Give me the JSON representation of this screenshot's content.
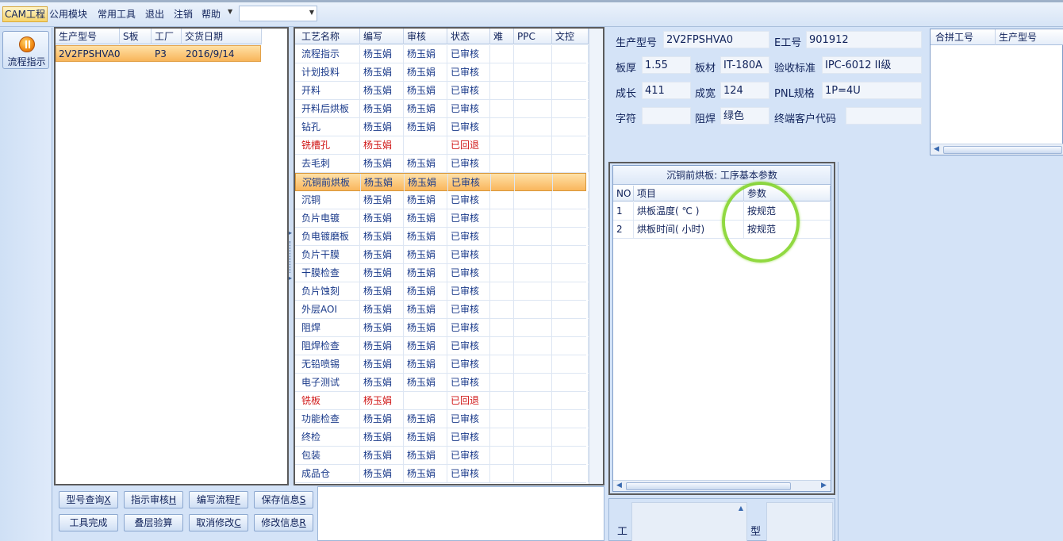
{
  "menu": {
    "items": [
      "CAM工程",
      "公用模块",
      "常用工具",
      "退出",
      "注销",
      "帮助"
    ],
    "combo_value": ""
  },
  "leftnav": {
    "label": "流程指示"
  },
  "product_list": {
    "headers": [
      "生产型号",
      "S板",
      "工厂",
      "交货日期"
    ],
    "rows": [
      {
        "model": "2V2FPSHVA0",
        "s": "",
        "factory": "P3",
        "date": "2016/9/14"
      }
    ]
  },
  "process_list": {
    "headers": [
      "工艺名称",
      "编写",
      "审核",
      "状态",
      "难",
      "PPC",
      "文控"
    ],
    "rows": [
      {
        "name": "流程指示",
        "writer": "杨玉娟",
        "auditor": "杨玉娟",
        "status": "已审核",
        "state": "normal"
      },
      {
        "name": "计划投料",
        "writer": "杨玉娟",
        "auditor": "杨玉娟",
        "status": "已审核",
        "state": "normal"
      },
      {
        "name": "开料",
        "writer": "杨玉娟",
        "auditor": "杨玉娟",
        "status": "已审核",
        "state": "normal"
      },
      {
        "name": "开料后烘板",
        "writer": "杨玉娟",
        "auditor": "杨玉娟",
        "status": "已审核",
        "state": "normal"
      },
      {
        "name": "钻孔",
        "writer": "杨玉娟",
        "auditor": "杨玉娟",
        "status": "已审核",
        "state": "normal"
      },
      {
        "name": "铣槽孔",
        "writer": "杨玉娟",
        "auditor": "",
        "status": "已回退",
        "state": "red"
      },
      {
        "name": "去毛刺",
        "writer": "杨玉娟",
        "auditor": "杨玉娟",
        "status": "已审核",
        "state": "normal"
      },
      {
        "name": "沉铜前烘板",
        "writer": "杨玉娟",
        "auditor": "杨玉娟",
        "status": "已审核",
        "state": "sel"
      },
      {
        "name": "沉铜",
        "writer": "杨玉娟",
        "auditor": "杨玉娟",
        "status": "已审核",
        "state": "normal"
      },
      {
        "name": "负片电镀",
        "writer": "杨玉娟",
        "auditor": "杨玉娟",
        "status": "已审核",
        "state": "normal"
      },
      {
        "name": "负电镀磨板",
        "writer": "杨玉娟",
        "auditor": "杨玉娟",
        "status": "已审核",
        "state": "normal"
      },
      {
        "name": "负片干膜",
        "writer": "杨玉娟",
        "auditor": "杨玉娟",
        "status": "已审核",
        "state": "normal"
      },
      {
        "name": "干膜检查",
        "writer": "杨玉娟",
        "auditor": "杨玉娟",
        "status": "已审核",
        "state": "normal"
      },
      {
        "name": "负片蚀刻",
        "writer": "杨玉娟",
        "auditor": "杨玉娟",
        "status": "已审核",
        "state": "normal"
      },
      {
        "name": "外层AOI",
        "writer": "杨玉娟",
        "auditor": "杨玉娟",
        "status": "已审核",
        "state": "normal"
      },
      {
        "name": "阻焊",
        "writer": "杨玉娟",
        "auditor": "杨玉娟",
        "status": "已审核",
        "state": "normal"
      },
      {
        "name": "阻焊检查",
        "writer": "杨玉娟",
        "auditor": "杨玉娟",
        "status": "已审核",
        "state": "normal"
      },
      {
        "name": "无铅喷锡",
        "writer": "杨玉娟",
        "auditor": "杨玉娟",
        "status": "已审核",
        "state": "normal"
      },
      {
        "name": "电子测试",
        "writer": "杨玉娟",
        "auditor": "杨玉娟",
        "status": "已审核",
        "state": "normal"
      },
      {
        "name": "铣板",
        "writer": "杨玉娟",
        "auditor": "",
        "status": "已回退",
        "state": "red"
      },
      {
        "name": "功能检查",
        "writer": "杨玉娟",
        "auditor": "杨玉娟",
        "status": "已审核",
        "state": "normal"
      },
      {
        "name": "终检",
        "writer": "杨玉娟",
        "auditor": "杨玉娟",
        "status": "已审核",
        "state": "normal"
      },
      {
        "name": "包装",
        "writer": "杨玉娟",
        "auditor": "杨玉娟",
        "status": "已审核",
        "state": "normal"
      },
      {
        "name": "成品仓",
        "writer": "杨玉娟",
        "auditor": "杨玉娟",
        "status": "已审核",
        "state": "normal"
      }
    ]
  },
  "buttons": [
    {
      "text": "型号查询",
      "key": "X"
    },
    {
      "text": "指示审核",
      "key": "H"
    },
    {
      "text": "编写流程",
      "key": "F"
    },
    {
      "text": "保存信息",
      "key": "S"
    },
    {
      "text": "工具完成",
      "key": ""
    },
    {
      "text": "叠层验算",
      "key": ""
    },
    {
      "text": "取消修改",
      "key": "C"
    },
    {
      "text": "修改信息",
      "key": "R"
    }
  ],
  "info": {
    "model_label": "生产型号",
    "model": "2V2FPSHVA0",
    "eno_label": "E工号",
    "eno": "901912",
    "thick_label": "板厚",
    "thick": "1.55",
    "mat_label": "板材",
    "mat": "IT-180A",
    "std_label": "验收标准",
    "std": "IPC-6012 II级",
    "len_label": "成长",
    "len": "411",
    "wid_label": "成宽",
    "wid": "124",
    "pnl_label": "PNL规格",
    "pnl": "1P=4U",
    "char_label": "字符",
    "char": "",
    "mask_label": "阻焊",
    "mask": "绿色",
    "cust_label": "终端客户代码",
    "cust": ""
  },
  "merge_table": {
    "headers": [
      "合拼工号",
      "生产型号"
    ]
  },
  "params": {
    "title": "沉铜前烘板: 工序基本参数",
    "headers": [
      "NO",
      "项目",
      "参数"
    ],
    "rows": [
      {
        "no": "1",
        "item": "烘板温度( ℃ )",
        "value": "按规范"
      },
      {
        "no": "2",
        "item": "烘板时间( 小时)",
        "value": "按规范"
      }
    ],
    "highlight_color": "#7ed321"
  },
  "bottom": {
    "label_a": "工",
    "label_b": "型"
  }
}
